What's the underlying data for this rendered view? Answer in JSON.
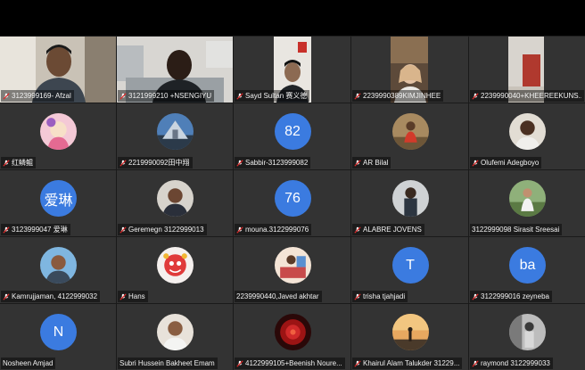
{
  "participants": [
    {
      "name": "3123999169- Afzal"
    },
    {
      "name": "3121999210 +NSENGIYU"
    },
    {
      "name": "Sayd Sultan 赛义德"
    },
    {
      "name": "2239990389KIMJINHEE"
    },
    {
      "name": "2239990040+KHEEREEKUNS..."
    },
    {
      "name": "红鳞鲲"
    },
    {
      "name": "2219990092田中翔"
    },
    {
      "name": "Sabbir-3123999082",
      "initials": "82"
    },
    {
      "name": "AR Bilal"
    },
    {
      "name": "Olufemi Adegboyo"
    },
    {
      "name": "3123999047 爱琳",
      "initials": "爱琳"
    },
    {
      "name": "Geremegn 3122999013"
    },
    {
      "name": "mouna.3122999076",
      "initials": "76"
    },
    {
      "name": "ALABRE JOVENS"
    },
    {
      "name": "3122999098 Sirasit Sreesai"
    },
    {
      "name": "Kamrujjaman, 4122999032"
    },
    {
      "name": "Hans"
    },
    {
      "name": "2239990440,Javed akhtar"
    },
    {
      "name": "trisha tjahjadi",
      "initials": "T"
    },
    {
      "name": "3122999016 zeyneba",
      "initials": "ba"
    },
    {
      "name": "Nosheen Amjad",
      "initials": "N"
    },
    {
      "name": "Subri Hussein Bakheet Emam"
    },
    {
      "name": "4122999105+Beenish Noure..."
    },
    {
      "name": "Khairul Alam Talukder 31229..."
    },
    {
      "name": "raymond 3122999033"
    }
  ],
  "colors": {
    "avatar_bg": "#3b7be0",
    "tile_bg": "#333333",
    "mute_icon": "#e02828"
  }
}
